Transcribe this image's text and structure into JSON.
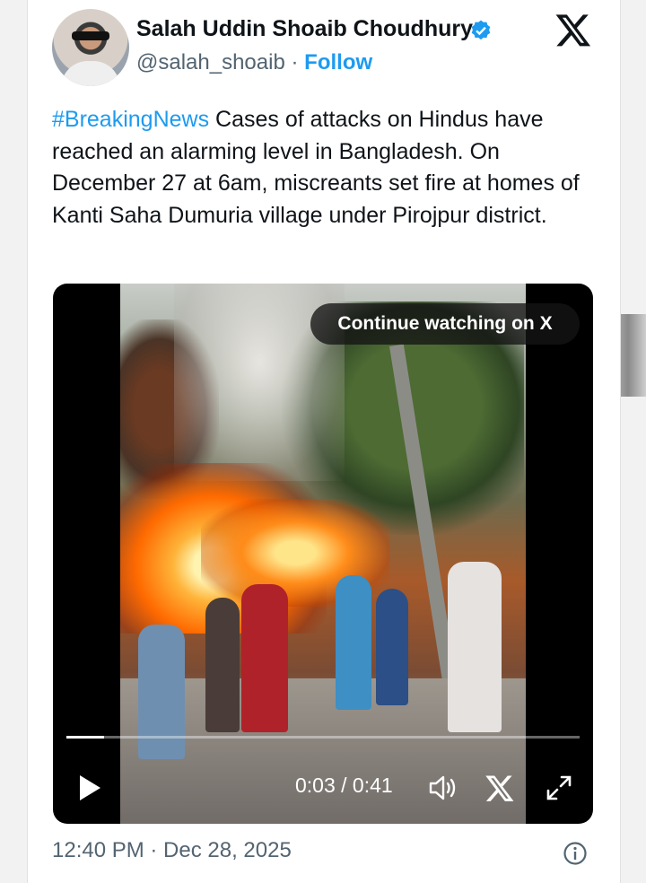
{
  "author": {
    "name": "Salah Uddin Shoaib Choudhury",
    "handle": "@salah_shoaib",
    "separator": "·",
    "follow_label": "Follow",
    "verified_icon": "verified-badge-icon"
  },
  "tweet": {
    "hashtag": "#BreakingNews",
    "body": " Cases of attacks on Hindus have reached an alarming level in Bangladesh. On December 27 at 6am, miscreants set fire at homes of Kanti Saha Dumuria village under Pirojpur district.",
    "timestamp": "12:40 PM · Dec 28, 2025"
  },
  "video": {
    "overlay_label": "Continue watching on X",
    "time": "0:03 / 0:41",
    "progress_fraction": 0.073
  },
  "colors": {
    "accent": "#1d9bf0",
    "text": "#0f1419",
    "muted": "#536471",
    "top_accent": "#e0245e"
  },
  "icons": [
    "x-logo-icon",
    "play-icon",
    "volume-icon",
    "x-small-icon",
    "fullscreen-icon",
    "info-icon"
  ]
}
